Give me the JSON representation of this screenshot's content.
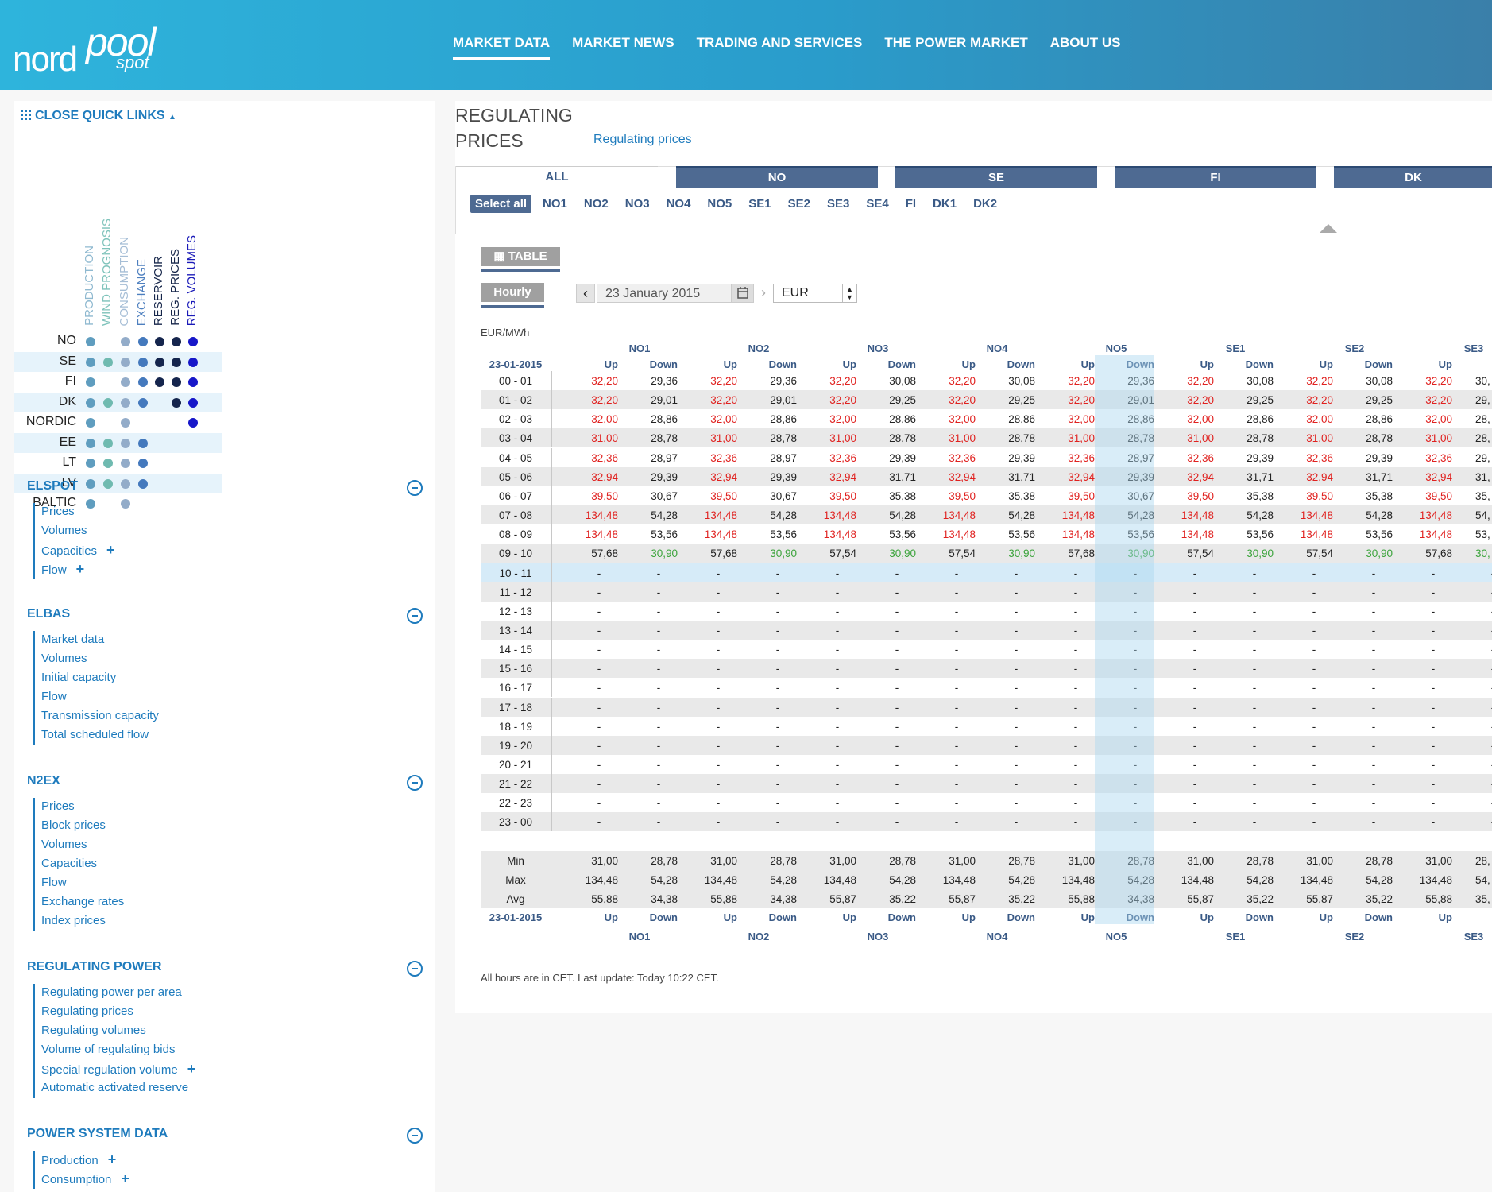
{
  "header": {
    "logo": {
      "part1": "nord",
      "part2": "pool",
      "part3": "spot"
    },
    "nav": [
      "MARKET DATA",
      "MARKET NEWS",
      "TRADING AND SERVICES",
      "THE POWER MARKET",
      "ABOUT US"
    ]
  },
  "sidebar": {
    "quick_links_label": "CLOSE QUICK LINKS",
    "matrix": {
      "columns": [
        {
          "label": "PRODUCTION",
          "color": "#8fb9d0"
        },
        {
          "label": "WIND PROGNOSIS",
          "color": "#7fc3bb"
        },
        {
          "label": "CONSUMPTION",
          "color": "#a6bed6"
        },
        {
          "label": "EXCHANGE",
          "color": "#4d7fbf"
        },
        {
          "label": "RESERVOIR",
          "color": "#16264a"
        },
        {
          "label": "REG. PRICES",
          "color": "#16264a"
        },
        {
          "label": "REG. VOLUMES",
          "color": "#1a1ab8"
        }
      ],
      "dot_colors": [
        "#5f9dbf",
        "#6fbab0",
        "#93acc9",
        "#4479bd",
        "#15254d",
        "#15254d",
        "#1717c9"
      ],
      "rows": [
        {
          "label": "NO",
          "dots": [
            1,
            0,
            1,
            1,
            1,
            1,
            1
          ],
          "band": false
        },
        {
          "label": "SE",
          "dots": [
            1,
            1,
            1,
            1,
            1,
            1,
            1
          ],
          "band": true
        },
        {
          "label": "FI",
          "dots": [
            1,
            0,
            1,
            1,
            1,
            1,
            1
          ],
          "band": false
        },
        {
          "label": "DK",
          "dots": [
            1,
            1,
            1,
            1,
            0,
            1,
            1
          ],
          "band": true
        },
        {
          "label": "NORDIC",
          "dots": [
            1,
            0,
            1,
            0,
            0,
            0,
            1
          ],
          "band": false
        },
        {
          "label": "EE",
          "dots": [
            1,
            1,
            1,
            1,
            0,
            0,
            0
          ],
          "band": true
        },
        {
          "label": "LT",
          "dots": [
            1,
            1,
            1,
            1,
            0,
            0,
            0
          ],
          "band": false
        },
        {
          "label": "LV",
          "dots": [
            1,
            1,
            1,
            1,
            0,
            0,
            0
          ],
          "band": true
        },
        {
          "label": "BALTIC",
          "dots": [
            1,
            0,
            1,
            0,
            0,
            0,
            0
          ],
          "band": false
        }
      ]
    },
    "sections": [
      {
        "title": "ELSPOT",
        "links": [
          {
            "label": "Prices"
          },
          {
            "label": "Volumes"
          },
          {
            "label": "Capacities",
            "plus": true
          },
          {
            "label": "Flow",
            "plus": true
          }
        ]
      },
      {
        "title": "ELBAS",
        "links": [
          {
            "label": "Market data"
          },
          {
            "label": "Volumes"
          },
          {
            "label": "Initial capacity"
          },
          {
            "label": "Flow"
          },
          {
            "label": "Transmission capacity"
          },
          {
            "label": "Total scheduled flow"
          }
        ]
      },
      {
        "title": "N2EX",
        "links": [
          {
            "label": "Prices"
          },
          {
            "label": "Block prices"
          },
          {
            "label": "Volumes"
          },
          {
            "label": "Capacities"
          },
          {
            "label": "Flow"
          },
          {
            "label": "Exchange rates"
          },
          {
            "label": "Index prices"
          }
        ]
      },
      {
        "title": "REGULATING POWER",
        "links": [
          {
            "label": "Regulating power per area"
          },
          {
            "label": "Regulating prices",
            "active": true
          },
          {
            "label": "Regulating volumes"
          },
          {
            "label": "Volume of regulating bids"
          },
          {
            "label": "Special regulation volume",
            "plus": true
          },
          {
            "label": "Automatic activated reserve"
          }
        ]
      },
      {
        "title": "POWER SYSTEM DATA",
        "links": [
          {
            "label": "Production",
            "plus": true
          },
          {
            "label": "Consumption",
            "plus": true
          }
        ]
      }
    ]
  },
  "main": {
    "title": "REGULATING PRICES",
    "subtitle": "Regulating prices",
    "tabs": [
      "ALL",
      "NO",
      "SE",
      "FI",
      "DK"
    ],
    "select_all": "Select all",
    "areas": [
      "NO1",
      "NO2",
      "NO3",
      "NO4",
      "NO5",
      "SE1",
      "SE2",
      "SE3",
      "SE4",
      "FI",
      "DK1",
      "DK2"
    ],
    "view_button": "TABLE",
    "resolution_button": "Hourly",
    "date": "23 January 2015",
    "currency": "EUR",
    "unit": "EUR/MWh",
    "table": {
      "date_label": "23-01-2015",
      "groups": [
        "NO1",
        "NO2",
        "NO3",
        "NO4",
        "NO5",
        "SE1",
        "SE2",
        "SE3"
      ],
      "sub_headers": [
        "Up",
        "Down"
      ],
      "hours": [
        "00 - 01",
        "01 - 02",
        "02 - 03",
        "03 - 04",
        "04 - 05",
        "05 - 06",
        "06 - 07",
        "07 - 08",
        "08 - 09",
        "09 - 10",
        "10 - 11",
        "11 - 12",
        "12 - 13",
        "13 - 14",
        "14 - 15",
        "15 - 16",
        "16 - 17",
        "17 - 18",
        "18 - 19",
        "19 - 20",
        "20 - 21",
        "21 - 22",
        "22 - 23",
        "23 - 00"
      ],
      "rows": [
        [
          "32,20",
          "29,36",
          "32,20",
          "29,36",
          "32,20",
          "30,08",
          "32,20",
          "30,08",
          "32,20",
          "29,36",
          "32,20",
          "30,08",
          "32,20",
          "30,08",
          "32,20",
          "30,"
        ],
        [
          "32,20",
          "29,01",
          "32,20",
          "29,01",
          "32,20",
          "29,25",
          "32,20",
          "29,25",
          "32,20",
          "29,01",
          "32,20",
          "29,25",
          "32,20",
          "29,25",
          "32,20",
          "29,"
        ],
        [
          "32,00",
          "28,86",
          "32,00",
          "28,86",
          "32,00",
          "28,86",
          "32,00",
          "28,86",
          "32,00",
          "28,86",
          "32,00",
          "28,86",
          "32,00",
          "28,86",
          "32,00",
          "28,"
        ],
        [
          "31,00",
          "28,78",
          "31,00",
          "28,78",
          "31,00",
          "28,78",
          "31,00",
          "28,78",
          "31,00",
          "28,78",
          "31,00",
          "28,78",
          "31,00",
          "28,78",
          "31,00",
          "28,"
        ],
        [
          "32,36",
          "28,97",
          "32,36",
          "28,97",
          "32,36",
          "29,39",
          "32,36",
          "29,39",
          "32,36",
          "28,97",
          "32,36",
          "29,39",
          "32,36",
          "29,39",
          "32,36",
          "29,"
        ],
        [
          "32,94",
          "29,39",
          "32,94",
          "29,39",
          "32,94",
          "31,71",
          "32,94",
          "31,71",
          "32,94",
          "29,39",
          "32,94",
          "31,71",
          "32,94",
          "31,71",
          "32,94",
          "31,"
        ],
        [
          "39,50",
          "30,67",
          "39,50",
          "30,67",
          "39,50",
          "35,38",
          "39,50",
          "35,38",
          "39,50",
          "30,67",
          "39,50",
          "35,38",
          "39,50",
          "35,38",
          "39,50",
          "35,"
        ],
        [
          "134,48",
          "54,28",
          "134,48",
          "54,28",
          "134,48",
          "54,28",
          "134,48",
          "54,28",
          "134,48",
          "54,28",
          "134,48",
          "54,28",
          "134,48",
          "54,28",
          "134,48",
          "54,"
        ],
        [
          "134,48",
          "53,56",
          "134,48",
          "53,56",
          "134,48",
          "53,56",
          "134,48",
          "53,56",
          "134,48",
          "53,56",
          "134,48",
          "53,56",
          "134,48",
          "53,56",
          "134,48",
          "53,"
        ],
        [
          "57,68",
          "30,90",
          "57,68",
          "30,90",
          "57,54",
          "30,90",
          "57,54",
          "30,90",
          "57,68",
          "30,90",
          "57,54",
          "30,90",
          "57,54",
          "30,90",
          "57,68",
          "30,"
        ]
      ],
      "summary": [
        {
          "label": "Min",
          "values": [
            "31,00",
            "28,78",
            "31,00",
            "28,78",
            "31,00",
            "28,78",
            "31,00",
            "28,78",
            "31,00",
            "28,78",
            "31,00",
            "28,78",
            "31,00",
            "28,78",
            "31,00",
            "28,"
          ]
        },
        {
          "label": "Max",
          "values": [
            "134,48",
            "54,28",
            "134,48",
            "54,28",
            "134,48",
            "54,28",
            "134,48",
            "54,28",
            "134,48",
            "54,28",
            "134,48",
            "54,28",
            "134,48",
            "54,28",
            "134,48",
            "54,"
          ]
        },
        {
          "label": "Avg",
          "values": [
            "55,88",
            "34,38",
            "55,88",
            "34,38",
            "55,87",
            "35,22",
            "55,87",
            "35,22",
            "55,88",
            "34,38",
            "55,87",
            "35,22",
            "55,87",
            "35,22",
            "55,88",
            "35,"
          ]
        }
      ],
      "footer_sub": [
        "Up",
        "Do"
      ],
      "down_truncated": "Dov"
    },
    "footnote": "All hours are in CET. Last update: Today 10:22 CET."
  },
  "colors": {
    "accent": "#1e7bbd",
    "tab_bg": "#4e6a92",
    "up_red": "#e0211f",
    "down_green": "#3aa33a"
  }
}
